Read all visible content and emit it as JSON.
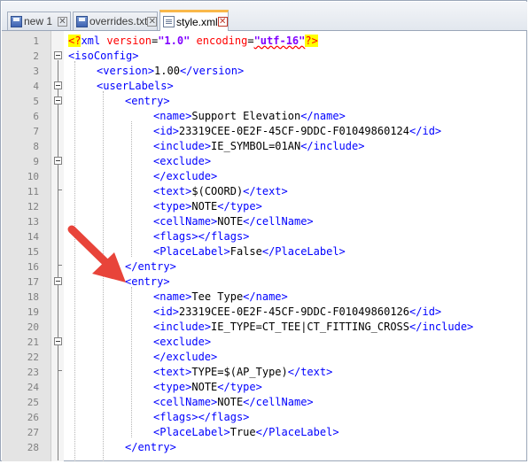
{
  "tabs": [
    {
      "label": "new 1",
      "icon": "floppy-disk-icon",
      "active": false
    },
    {
      "label": "overrides.txt",
      "icon": "floppy-disk-icon",
      "active": false
    },
    {
      "label": "style.xml",
      "icon": "document-icon",
      "active": true
    }
  ],
  "lines": [
    {
      "n": "1"
    },
    {
      "n": "2"
    },
    {
      "n": "3"
    },
    {
      "n": "4"
    },
    {
      "n": "5"
    },
    {
      "n": "6"
    },
    {
      "n": "7"
    },
    {
      "n": "8"
    },
    {
      "n": "9"
    },
    {
      "n": "10"
    },
    {
      "n": "11"
    },
    {
      "n": "12"
    },
    {
      "n": "13"
    },
    {
      "n": "14"
    },
    {
      "n": "15"
    },
    {
      "n": "16"
    },
    {
      "n": "17"
    },
    {
      "n": "18"
    },
    {
      "n": "19"
    },
    {
      "n": "20"
    },
    {
      "n": "21"
    },
    {
      "n": "22"
    },
    {
      "n": "23"
    },
    {
      "n": "24"
    },
    {
      "n": "25"
    },
    {
      "n": "26"
    },
    {
      "n": "27"
    },
    {
      "n": "28"
    }
  ],
  "xml": {
    "decl_open": "<?",
    "decl_name": "xml",
    "decl_attr1": "version",
    "decl_val1": "\"1.0\"",
    "decl_attr2": "encoding",
    "decl_val2": "\"utf-16\"",
    "decl_close": "?>",
    "isoConfig": "isoConfig",
    "version": "version",
    "version_value": "1.00",
    "userLabels": "userLabels",
    "entry": "entry",
    "name": "name",
    "id": "id",
    "include": "include",
    "exclude": "exclude",
    "text": "text",
    "type": "type",
    "cellName": "cellName",
    "flags": "flags",
    "PlaceLabel": "PlaceLabel"
  },
  "entries": [
    {
      "name": "Support Elevation",
      "id": "23319CEE-0E2F-45CF-9DDC-F01049860124",
      "include": "IE_SYMBOL=01AN",
      "text": "$(COORD)",
      "type": "NOTE",
      "cellName": "NOTE",
      "placeLabel": "False"
    },
    {
      "name": "Tee Type",
      "id": "23319CEE-0E2F-45CF-9DDC-F01049860126",
      "include": "IE_TYPE=CT_TEE|CT_FITTING_CROSS",
      "text": "TYPE=$(AP_Type)",
      "type": "NOTE",
      "cellName": "NOTE",
      "placeLabel": "True"
    }
  ],
  "annotation": {
    "color": "#e8443a",
    "icon": "red-arrow-icon"
  }
}
